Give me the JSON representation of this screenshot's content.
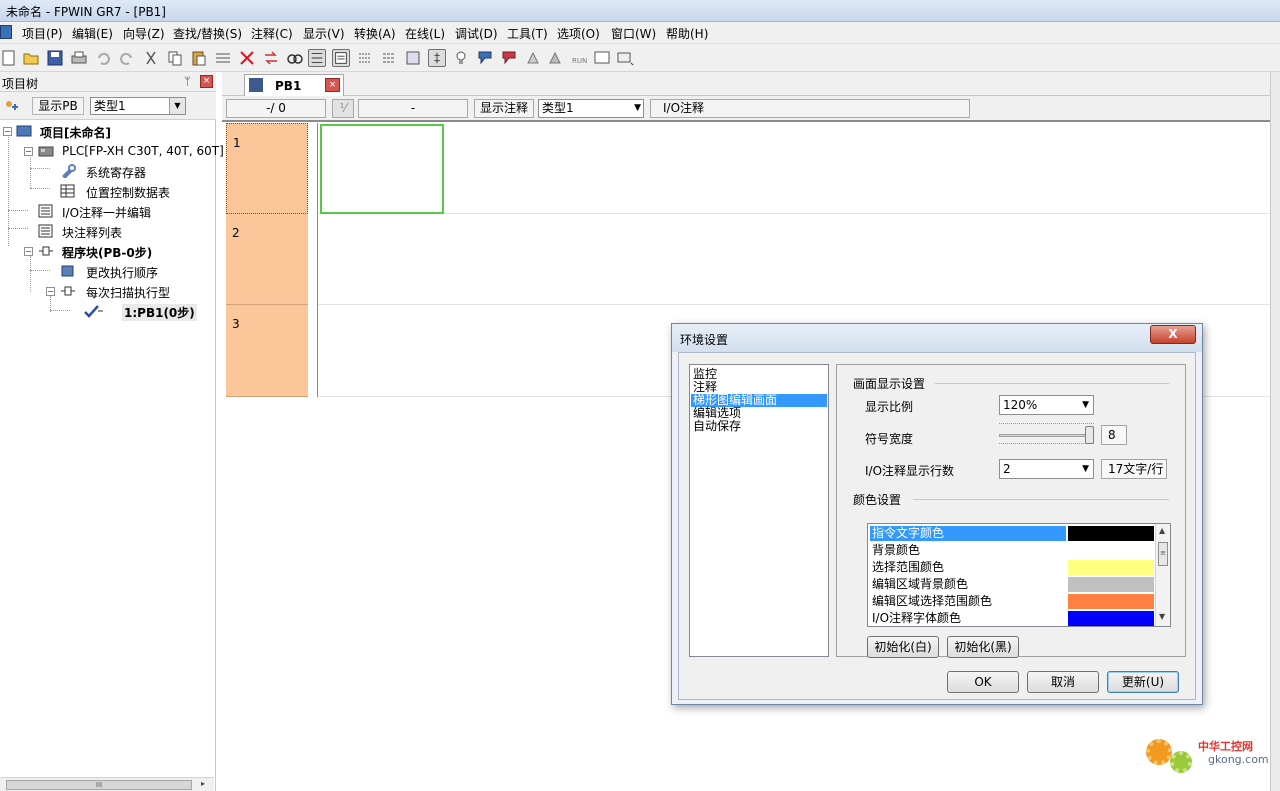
{
  "window": {
    "title": "未命名 - FPWIN GR7 - [PB1]"
  },
  "menu": [
    "项目(P)",
    "编辑(E)",
    "向导(Z)",
    "查找/替换(S)",
    "注释(C)",
    "显示(V)",
    "转换(A)",
    "在线(L)",
    "调试(D)",
    "工具(T)",
    "选项(O)",
    "窗口(W)",
    "帮助(H)"
  ],
  "left_panel": {
    "title": "项目树",
    "show_pb_label": "显示PB",
    "type_value": "类型1",
    "tree": {
      "project": "项目[未命名]",
      "plc": "PLC[FP-XH C30T, 40T, 60T]",
      "system_register": "系统寄存器",
      "position_table": "位置控制数据表",
      "io_comment": "I/O注释一并编辑",
      "block_comment": "块注释列表",
      "program_block": "程序块(PB-0步)",
      "change_order": "更改执行顺序",
      "each_scan": "每次扫描执行型",
      "pb1": "1:PB1(0步)"
    }
  },
  "editor": {
    "tab_label": "PB1",
    "position_display": "-/ 0",
    "field_display": "-",
    "show_comment_label": "显示注释",
    "type_value": "类型1",
    "io_comment_label": "I/O注释",
    "rows": [
      "1",
      "2",
      "3"
    ]
  },
  "dialog": {
    "title": "环境设置",
    "close_label": "X",
    "categories": [
      "监控",
      "注释",
      "梯形图编辑画面",
      "编辑选项",
      "自动保存"
    ],
    "selected_category_index": 2,
    "display_group": "画面显示设置",
    "zoom_label": "显示比例",
    "zoom_value": "120%",
    "symbol_width_label": "符号宽度",
    "symbol_width_value": "8",
    "symbol_width_fraction": 1.0,
    "io_lines_label": "I/O注释显示行数",
    "io_lines_value": "2",
    "io_chars_value": "17文字/行",
    "color_group": "颜色设置",
    "colors": [
      {
        "name": "指令文字颜色",
        "color": "#000000"
      },
      {
        "name": "背景颜色",
        "color": "#ffffff"
      },
      {
        "name": "选择范围颜色",
        "color": "#ffff80"
      },
      {
        "name": "编辑区域背景颜色",
        "color": "#c0c0c0"
      },
      {
        "name": "编辑区域选择范围颜色",
        "color": "#ff8040"
      },
      {
        "name": "I/O注释字体颜色",
        "color": "#0000ff"
      }
    ],
    "init_white": "初始化(白)",
    "init_black": "初始化(黑)",
    "ok": "OK",
    "cancel": "取消",
    "update": "更新(U)"
  },
  "watermark": {
    "line1": "中华工控网",
    "line2": "gkong.com"
  }
}
